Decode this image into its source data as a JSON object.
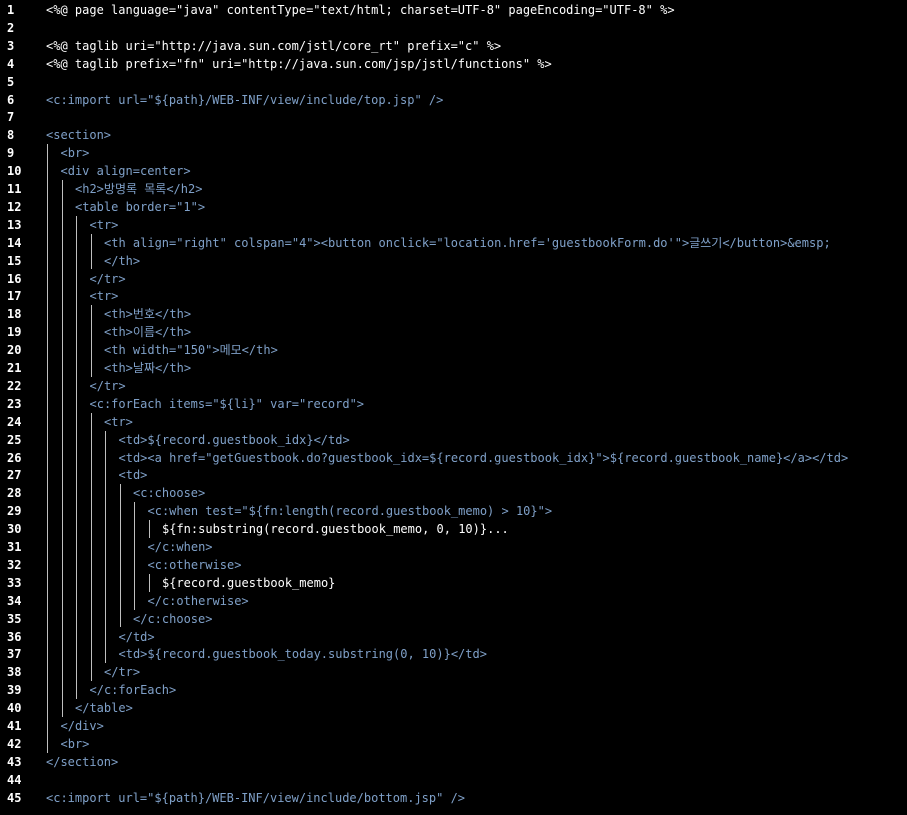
{
  "editor": {
    "background": "#000000",
    "tag_color": "#7fa0c8",
    "jsp_delim_color": "#ff9a63",
    "lines": [
      {
        "n": "1",
        "indent": 0,
        "text": "<%@ page language=\"java\" contentType=\"text/html; charset=UTF-8\" pageEncoding=\"UTF-8\" %>"
      },
      {
        "n": "2",
        "indent": 0,
        "text": ""
      },
      {
        "n": "3",
        "indent": 0,
        "text": "<%@ taglib uri=\"http://java.sun.com/jstl/core_rt\" prefix=\"c\" %>"
      },
      {
        "n": "4",
        "indent": 0,
        "text": "<%@ taglib prefix=\"fn\" uri=\"http://java.sun.com/jsp/jstl/functions\" %>"
      },
      {
        "n": "5",
        "indent": 0,
        "text": ""
      },
      {
        "n": "6",
        "indent": 0,
        "text": "<c:import url=\"${path}/WEB-INF/view/include/top.jsp\" />"
      },
      {
        "n": "7",
        "indent": 0,
        "text": ""
      },
      {
        "n": "8",
        "indent": 0,
        "text": "<section>"
      },
      {
        "n": "9",
        "indent": 1,
        "text": "<br>"
      },
      {
        "n": "10",
        "indent": 1,
        "text": "<div align=center>"
      },
      {
        "n": "11",
        "indent": 2,
        "text": "<h2>방명록 목록</h2>"
      },
      {
        "n": "12",
        "indent": 2,
        "text": "<table border=\"1\">"
      },
      {
        "n": "13",
        "indent": 3,
        "text": "<tr>"
      },
      {
        "n": "14",
        "indent": 4,
        "text": "<th align=\"right\" colspan=\"4\"><button onclick=\"location.href='guestbookForm.do'\">글쓰기</button>&emsp;"
      },
      {
        "n": "15",
        "indent": 4,
        "text": "</th>"
      },
      {
        "n": "16",
        "indent": 3,
        "text": "</tr>"
      },
      {
        "n": "17",
        "indent": 3,
        "text": "<tr>"
      },
      {
        "n": "18",
        "indent": 4,
        "text": "<th>번호</th>"
      },
      {
        "n": "19",
        "indent": 4,
        "text": "<th>이름</th>"
      },
      {
        "n": "20",
        "indent": 4,
        "text": "<th width=\"150\">메모</th>"
      },
      {
        "n": "21",
        "indent": 4,
        "text": "<th>날짜</th>"
      },
      {
        "n": "22",
        "indent": 3,
        "text": "</tr>"
      },
      {
        "n": "23",
        "indent": 3,
        "text": "<c:forEach items=\"${li}\" var=\"record\">"
      },
      {
        "n": "24",
        "indent": 4,
        "text": "<tr>"
      },
      {
        "n": "25",
        "indent": 5,
        "text": "<td>${record.guestbook_idx}</td>"
      },
      {
        "n": "26",
        "indent": 5,
        "text": "<td><a href=\"getGuestbook.do?guestbook_idx=${record.guestbook_idx}\">${record.guestbook_name}</a></td>"
      },
      {
        "n": "27",
        "indent": 5,
        "text": "<td>"
      },
      {
        "n": "28",
        "indent": 6,
        "text": "<c:choose>"
      },
      {
        "n": "29",
        "indent": 7,
        "text": "<c:when test=\"${fn:length(record.guestbook_memo) > 10}\">"
      },
      {
        "n": "30",
        "indent": 8,
        "text": "${fn:substring(record.guestbook_memo, 0, 10)}..."
      },
      {
        "n": "31",
        "indent": 7,
        "text": "</c:when>"
      },
      {
        "n": "32",
        "indent": 7,
        "text": "<c:otherwise>"
      },
      {
        "n": "33",
        "indent": 8,
        "text": "${record.guestbook_memo}"
      },
      {
        "n": "34",
        "indent": 7,
        "text": "</c:otherwise>"
      },
      {
        "n": "35",
        "indent": 6,
        "text": "</c:choose>"
      },
      {
        "n": "36",
        "indent": 5,
        "text": "</td>"
      },
      {
        "n": "37",
        "indent": 5,
        "text": "<td>${record.guestbook_today.substring(0, 10)}</td>"
      },
      {
        "n": "38",
        "indent": 4,
        "text": "</tr>"
      },
      {
        "n": "39",
        "indent": 3,
        "text": "</c:forEach>"
      },
      {
        "n": "40",
        "indent": 2,
        "text": "</table>"
      },
      {
        "n": "41",
        "indent": 1,
        "text": "</div>"
      },
      {
        "n": "42",
        "indent": 1,
        "text": "<br>"
      },
      {
        "n": "43",
        "indent": 0,
        "text": "</section>"
      },
      {
        "n": "44",
        "indent": 0,
        "text": ""
      },
      {
        "n": "45",
        "indent": 0,
        "text": "<c:import url=\"${path}/WEB-INF/view/include/bottom.jsp\" />"
      }
    ]
  }
}
